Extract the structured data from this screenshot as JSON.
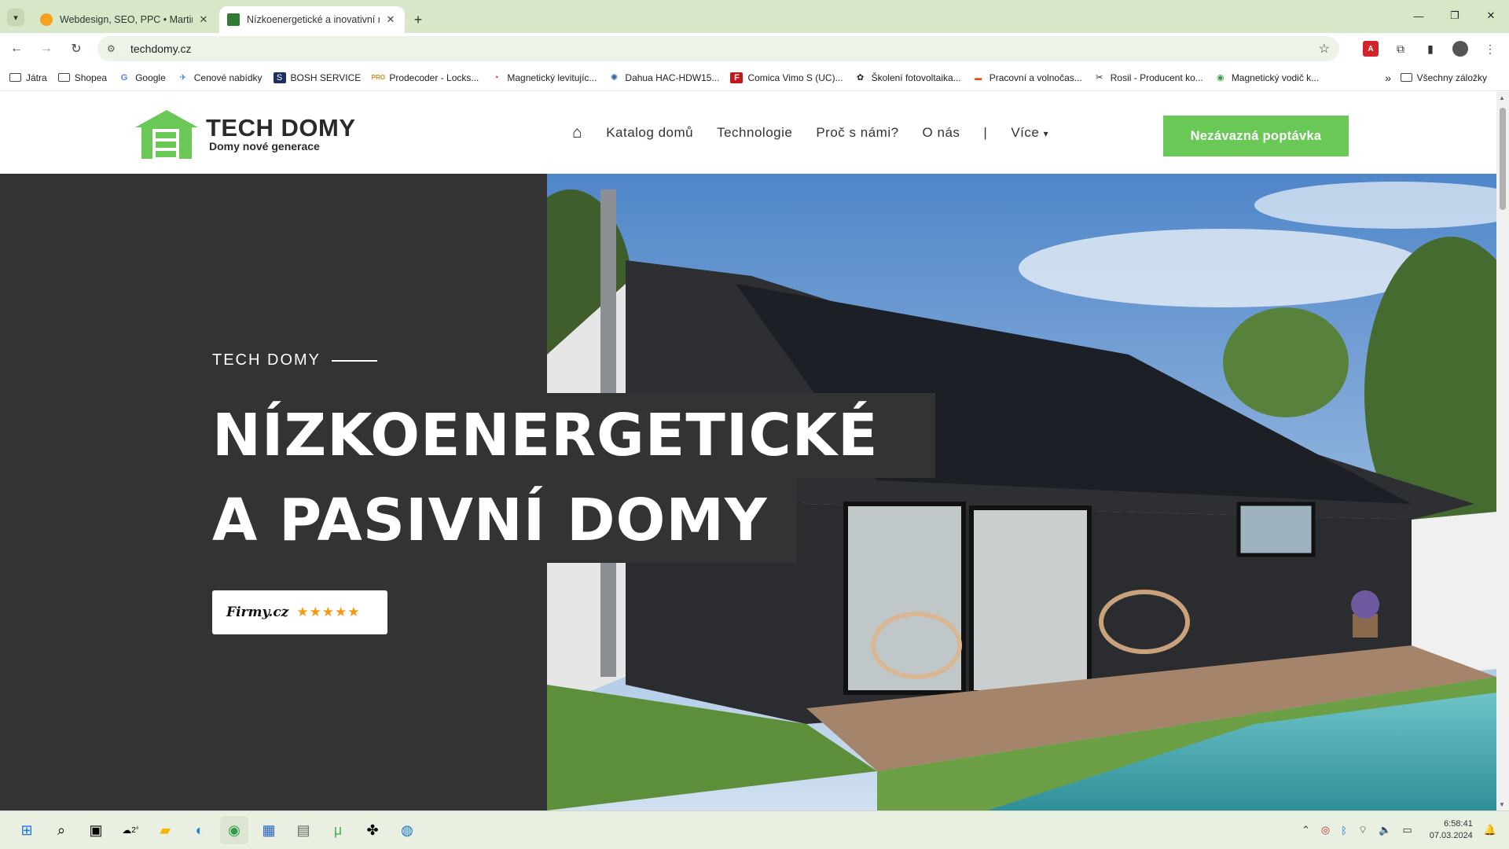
{
  "browser": {
    "tabs": [
      {
        "title": "Webdesign, SEO, PPC • Martin",
        "favicon_color": "#f5a11c",
        "active": false
      },
      {
        "title": "Nízkoenergetické a inovativní r",
        "favicon_color": "#2e7d32",
        "active": true
      }
    ],
    "new_tab_label": "+",
    "url": "techdomy.cz",
    "bookmarks": [
      {
        "label": "Játra",
        "icon": "folder-icon"
      },
      {
        "label": "Shopea",
        "icon": "folder-icon"
      },
      {
        "label": "Google",
        "icon": "google-icon"
      },
      {
        "label": "Cenové nabídky",
        "icon": "bird-icon"
      },
      {
        "label": "BOSH SERVICE",
        "icon": "bosh-icon"
      },
      {
        "label": "Prodecoder - Locks...",
        "icon": "pro-icon"
      },
      {
        "label": "Magnetický levitujíc...",
        "icon": "magnet-icon"
      },
      {
        "label": "Dahua HAC-HDW15...",
        "icon": "dahua-icon"
      },
      {
        "label": "Comica Vimo S (UC)...",
        "icon": "f-icon"
      },
      {
        "label": "Školení fotovoltaika...",
        "icon": "solar-icon"
      },
      {
        "label": "Pracovní a volnočas...",
        "icon": "pv-icon"
      },
      {
        "label": "Rosil - Producent ko...",
        "icon": "rosil-icon"
      },
      {
        "label": "Magnetický vodič k...",
        "icon": "chrome-icon"
      }
    ],
    "bookmarks_more": "»",
    "all_bookmarks": "Všechny záložky"
  },
  "site": {
    "logo_title": "TECH DOMY",
    "logo_subtitle": "Domy nové generace",
    "nav": [
      "Katalog domů",
      "Technologie",
      "Proč s námi?",
      "O nás"
    ],
    "nav_separator": "|",
    "nav_more": "Více",
    "cta": "Nezávazná poptávka",
    "brand_color": "#6ac956",
    "hero": {
      "eyebrow": "TECH DOMY",
      "headline_line1": "NÍZKOENERGETICKÉ",
      "headline_line2": "A PASIVNÍ DOMY",
      "badge_brand": "Firmy.cz",
      "badge_rating": 5
    }
  },
  "taskbar": {
    "weather_temp": "2°",
    "time": "6:58:41",
    "date": "07.03.2024"
  }
}
